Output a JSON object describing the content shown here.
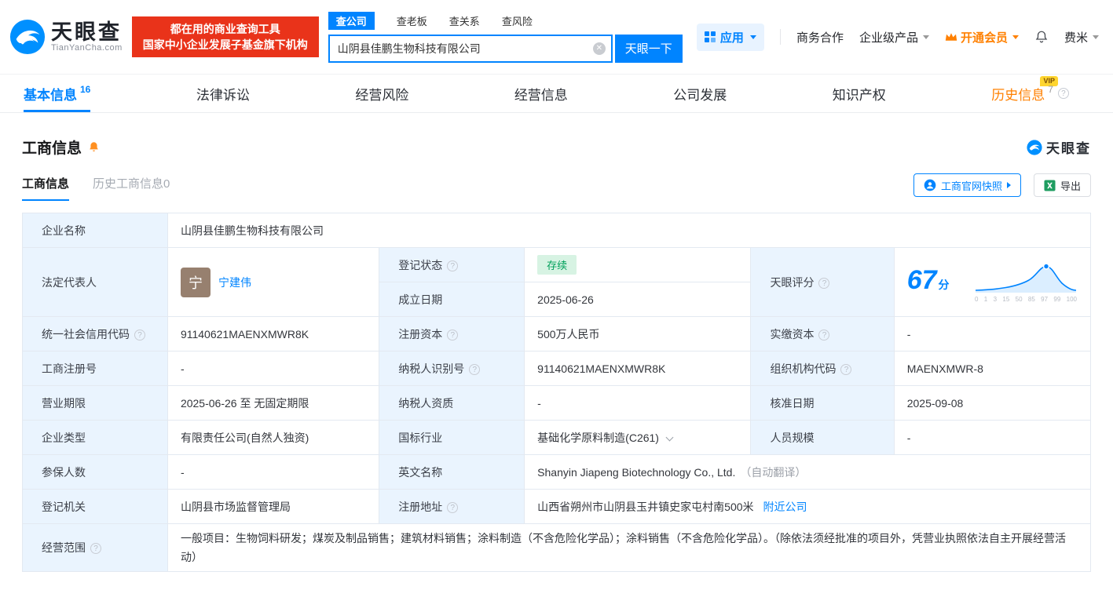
{
  "brand": {
    "name": "天眼查",
    "domain": "TianYanCha.com",
    "slogan_line1": "都在用的商业查询工具",
    "slogan_line2": "国家中小企业发展子基金旗下机构",
    "primary_color": "#0084ff",
    "red_color": "#e9331a"
  },
  "search": {
    "tabs": [
      {
        "label": "查公司"
      },
      {
        "label": "查老板"
      },
      {
        "label": "查关系"
      },
      {
        "label": "查风险"
      }
    ],
    "value": "山阴县佳鹏生物科技有限公司",
    "button_label": "天眼一下"
  },
  "topnav": {
    "apps": "应用",
    "business_coop": "商务合作",
    "enterprise_products": "企业级产品",
    "open_vip": "开通会员",
    "username": "费米"
  },
  "main_tabs": [
    {
      "label": "基本信息",
      "count": "16"
    },
    {
      "label": "法律诉讼",
      "count": ""
    },
    {
      "label": "经营风险",
      "count": ""
    },
    {
      "label": "经营信息",
      "count": ""
    },
    {
      "label": "公司发展",
      "count": ""
    },
    {
      "label": "知识产权",
      "count": ""
    },
    {
      "label": "历史信息",
      "count": "7",
      "badge": "VIP"
    }
  ],
  "section": {
    "title": "工商信息",
    "corner_logo": "天眼查",
    "subtabs": [
      {
        "label": "工商信息"
      },
      {
        "label": "历史工商信息0"
      }
    ],
    "snapshot_button": "工商官网快照",
    "export_button": "导出"
  },
  "info": {
    "company_name": {
      "label": "企业名称",
      "value": "山阴县佳鹏生物科技有限公司"
    },
    "legal_rep": {
      "label": "法定代表人",
      "avatar": "宁",
      "name": "宁建伟"
    },
    "reg_status": {
      "label": "登记状态",
      "value": "存续"
    },
    "establish_date": {
      "label": "成立日期",
      "value": "2025-06-26"
    },
    "score": {
      "label": "天眼评分"
    },
    "credit_code": {
      "label": "统一社会信用代码",
      "value": "91140621MAENXMWR8K"
    },
    "reg_capital": {
      "label": "注册资本",
      "value": "500万人民币"
    },
    "paid_capital": {
      "label": "实缴资本",
      "value": "-"
    },
    "reg_number": {
      "label": "工商注册号",
      "value": "-"
    },
    "taxpayer_id": {
      "label": "纳税人识别号",
      "value": "91140621MAENXMWR8K"
    },
    "org_code": {
      "label": "组织机构代码",
      "value": "MAENXMWR-8"
    },
    "business_term": {
      "label": "营业期限",
      "value": "2025-06-26 至 无固定期限"
    },
    "taxpayer_quality": {
      "label": "纳税人资质",
      "value": "-"
    },
    "approval_date": {
      "label": "核准日期",
      "value": "2025-09-08"
    },
    "company_type": {
      "label": "企业类型",
      "value": "有限责任公司(自然人独资)"
    },
    "industry": {
      "label": "国标行业",
      "value": "基础化学原料制造(C261)"
    },
    "staff_size": {
      "label": "人员规模",
      "value": "-"
    },
    "insured_count": {
      "label": "参保人数",
      "value": "-"
    },
    "english_name": {
      "label": "英文名称",
      "value": "Shanyin Jiapeng Biotechnology Co., Ltd.",
      "note": "（自动翻译）"
    },
    "reg_authority": {
      "label": "登记机关",
      "value": "山阴县市场监督管理局"
    },
    "reg_address": {
      "label": "注册地址",
      "value": "山西省朔州市山阴县玉井镇史家屯村南500米",
      "link": "附近公司"
    },
    "business_scope": {
      "label": "经营范围",
      "value": "一般项目：生物饲料研发；煤炭及制品销售；建筑材料销售；涂料制造（不含危险化学品）；涂料销售（不含危险化学品）。（除依法须经批准的项目外，凭营业执照依法自主开展经营活动）"
    }
  },
  "chart_data": {
    "type": "area",
    "title": "天眼评分",
    "score": 67,
    "unit": "分",
    "x_ticks": [
      "0",
      "1",
      "3",
      "15",
      "50",
      "85",
      "97",
      "99",
      "100"
    ],
    "color": "#0084ff",
    "note": "score distribution bell curve, marker placed at company score 67"
  }
}
